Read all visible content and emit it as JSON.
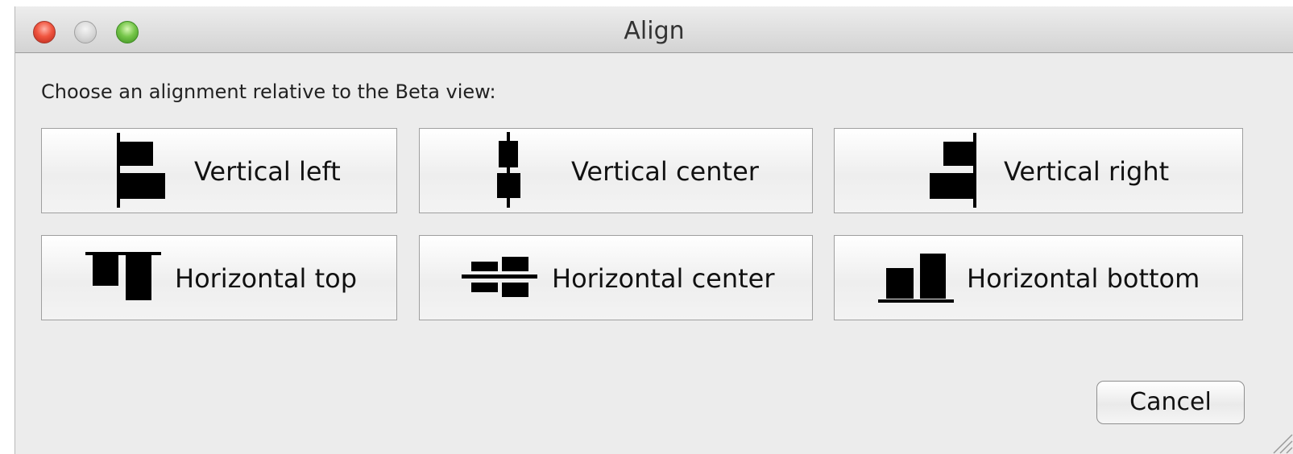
{
  "window": {
    "title": "Align"
  },
  "dialog": {
    "prompt": "Choose an alignment relative to the Beta view:",
    "options": [
      {
        "label": "Vertical left",
        "icon": "align-vertical-left-icon"
      },
      {
        "label": "Vertical center",
        "icon": "align-vertical-center-icon"
      },
      {
        "label": "Vertical right",
        "icon": "align-vertical-right-icon"
      },
      {
        "label": "Horizontal top",
        "icon": "align-horizontal-top-icon"
      },
      {
        "label": "Horizontal center",
        "icon": "align-horizontal-center-icon"
      },
      {
        "label": "Horizontal bottom",
        "icon": "align-horizontal-bottom-icon"
      }
    ],
    "cancel_label": "Cancel"
  }
}
